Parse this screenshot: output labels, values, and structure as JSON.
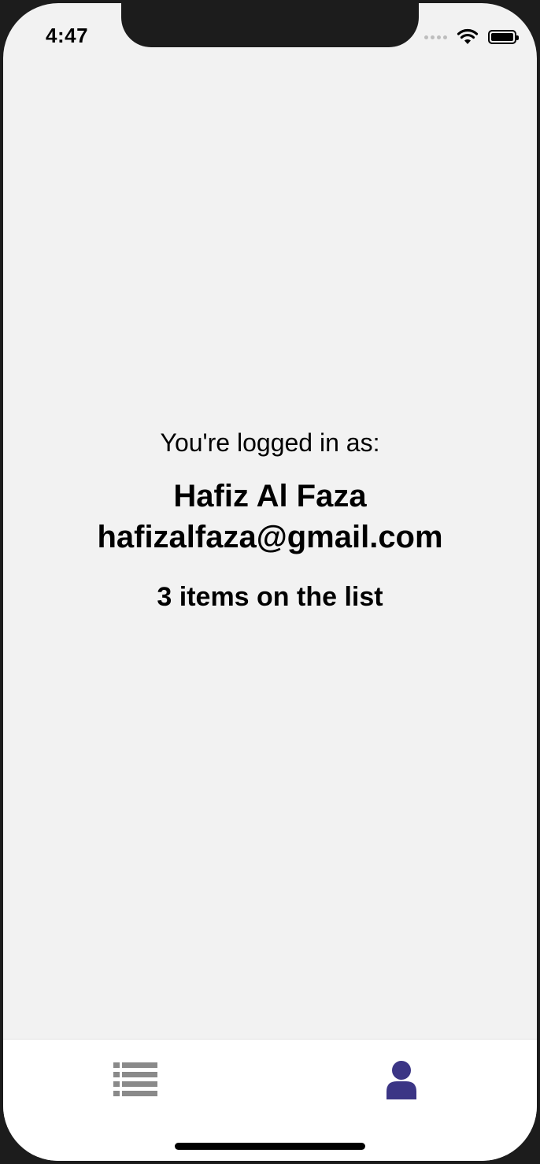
{
  "status_bar": {
    "time": "4:47"
  },
  "profile": {
    "logged_in_label": "You're logged in as:",
    "name": "Hafiz Al Faza",
    "email": "hafizalfaza@gmail.com",
    "items_count_text": "3 items on the list"
  },
  "tab_bar": {
    "tabs": [
      {
        "icon": "list-icon",
        "active": false
      },
      {
        "icon": "user-icon",
        "active": true
      }
    ]
  },
  "colors": {
    "background": "#f2f2f2",
    "tab_active": "#3b3585",
    "tab_inactive": "#8a8a8a",
    "text": "#000000"
  }
}
